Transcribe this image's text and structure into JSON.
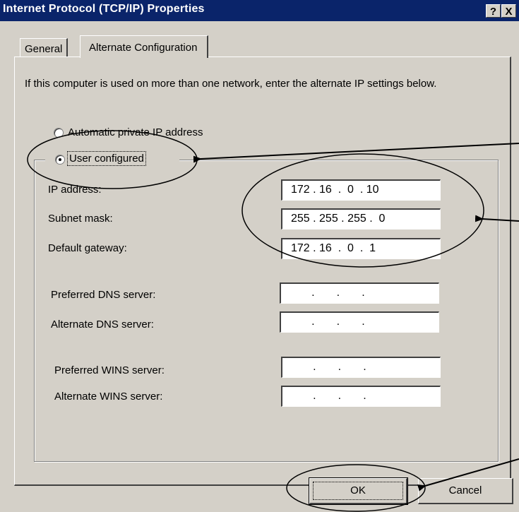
{
  "window": {
    "title": "Internet Protocol (TCP/IP) Properties",
    "help_label": "?",
    "close_label": "X"
  },
  "tabs": [
    {
      "label": "General",
      "active": false
    },
    {
      "label": "Alternate Configuration",
      "active": true
    }
  ],
  "description": "If this computer is used on more than one network, enter the alternate IP settings below.",
  "radios": [
    {
      "label": "Automatic private IP address",
      "checked": false
    },
    {
      "label": "User configured",
      "checked": true
    }
  ],
  "fields": {
    "ip_address": {
      "label": "IP address:",
      "value": "172 . 16  .  0  . 10"
    },
    "subnet_mask": {
      "label": "Subnet mask:",
      "value": "255 . 255 . 255 .  0"
    },
    "default_gateway": {
      "label": "Default gateway:",
      "value": "172 . 16  .  0  .  1"
    },
    "preferred_dns": {
      "label": "Preferred DNS server:",
      "value": "       .       .       ."
    },
    "alternate_dns": {
      "label": "Alternate DNS server:",
      "value": "       .       .       ."
    },
    "preferred_wins": {
      "label": "Preferred WINS server:",
      "value": "       .       .       ."
    },
    "alternate_wins": {
      "label": "Alternate WINS server:",
      "value": "       .       .       ."
    }
  },
  "buttons": {
    "ok": "OK",
    "cancel": "Cancel"
  },
  "annotation_color": "#000000"
}
